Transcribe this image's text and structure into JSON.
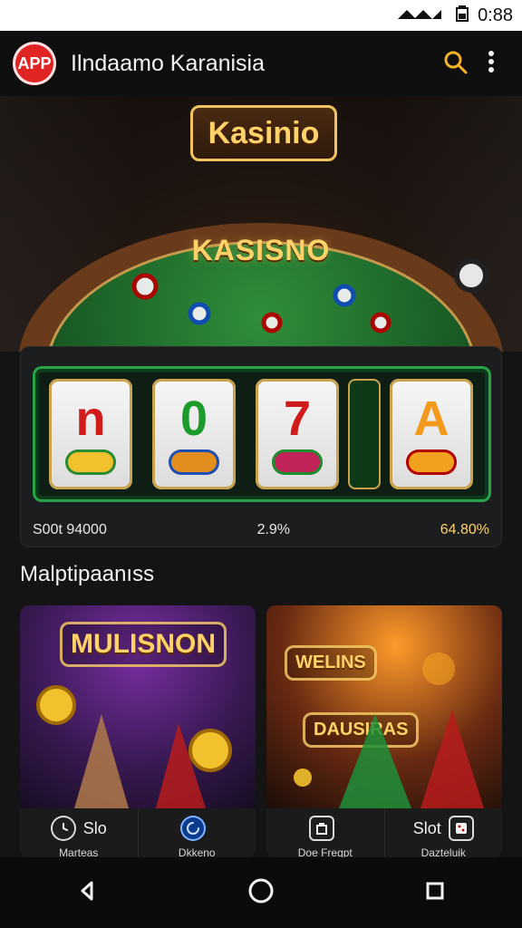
{
  "status_bar": {
    "time": "0:88"
  },
  "app_bar": {
    "logo_text": "APP",
    "title": "Ilndaamo Karanisia"
  },
  "hero": {
    "sign_text": "Kasinio",
    "felt_text": "KASISNO"
  },
  "slot": {
    "reel_symbols": [
      "n",
      "0",
      "7",
      "A"
    ],
    "footer_left": "S00t 94000",
    "footer_mid": "2.9%",
    "footer_right": "64.80%"
  },
  "section": {
    "title": "Malptipaanıss"
  },
  "cards": [
    {
      "badge": "MULISNON",
      "bottom": [
        {
          "label": "Slo",
          "sub": "Marteas",
          "icon": "clock-icon"
        },
        {
          "label": "",
          "sub": "Dkkeno",
          "icon": "spinner-icon"
        }
      ]
    },
    {
      "badge_top": "WELINS",
      "badge_bottom": "DAUSIRAS",
      "bottom": [
        {
          "label": "",
          "sub": "Doe Fregpt",
          "icon": "bag-icon"
        },
        {
          "label": "Slot",
          "sub": "Dazteluik",
          "icon": "dice-icon"
        }
      ]
    }
  ],
  "colors": {
    "accent": "#f3b22a",
    "felt_green": "#1f6a2b",
    "gold": "#ffd36a",
    "bg": "#141414"
  }
}
